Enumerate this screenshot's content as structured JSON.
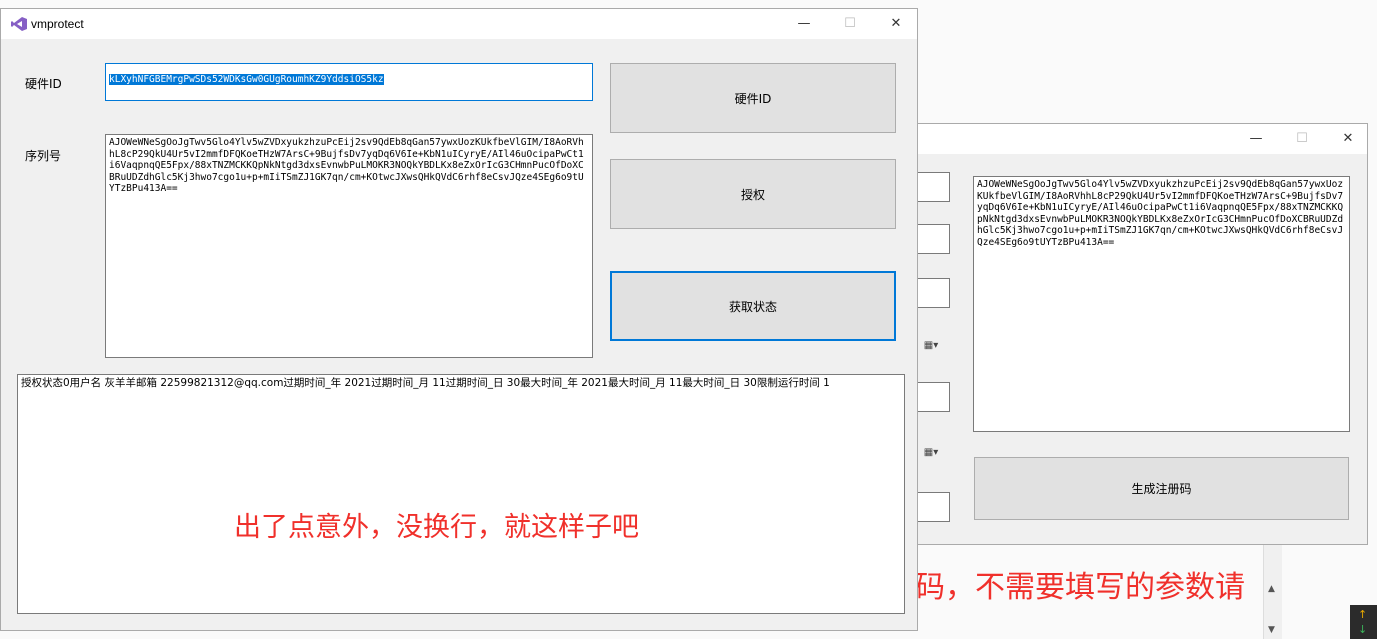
{
  "main_window": {
    "title": "vmprotect",
    "minimize": "—",
    "maximize": "☐",
    "close": "✕",
    "hardware_id_label": "硬件ID",
    "hardware_id_value": "kLXyhNFGBEMrgPwSDs52WDKsGw0GUgRoumhKZ9YddsiOS5kz",
    "serial_label": "序列号",
    "serial_value": "AJOWeWNeSgOoJgTwv5Glo4Ylv5wZVDxyukzhzuPcEij2sv9QdEb8qGan57ywxUozKUkfbeVlGIM/I8AoRVhhL8cP29QkU4Ur5vI2mmfDFQKoeTHzW7ArsC+9BujfsDv7yqDq6V6Ie+KbN1uICyryE/AIl46uOcipaPwCt1i6VaqpnqQE5Fpx/88xTNZMCKKQpNkNtgd3dxsEvnwbPuLMOKR3NOQkYBDLKx8eZxOrIcG3CHmnPucOfDoXCBRuUDZdhGlc5Kj3hwo7cgo1u+p+mIiTSmZJ1GK7qn/cm+KOtwcJXwsQHkQVdC6rhf8eCsvJQze4SEg6o9tUYTzBPu413A==",
    "btn_hardware_id": "硬件ID",
    "btn_authorize": "授权",
    "btn_get_status": "获取状态",
    "status_text": "授权状态0用户名  灰羊羊邮箱  2259982131​2@qq.com过期时间_年  2021过期时间_月  11过期时间_日  30最大时间_年 2021最大时间_月 11最大时间_日 30限制运行时间 1",
    "annotation": "出了点意外，没换行，就这样子吧"
  },
  "second_window": {
    "minimize": "—",
    "maximize": "☐",
    "close": "✕",
    "serial_value": "AJOWeWNeSgOoJgTwv5Glo4Ylv5wZVDxyukzhzuPcEij2sv9QdEb8qGan57ywxUozKUkfbeVlGIM/I8AoRVhhL8cP29QkU4Ur5vI2mmfDFQKoeTHzW7ArsC+9BujfsDv7yqDq6V6Ie+KbN1uICyryE/AIl46uOcipaPwCt1i6VaqpnqQE5Fpx/88xTNZMCKKQpNkNtgd3dxsEvnwbPuLMOKR3NOQkYBDLKx8eZxOrIcG3CHmnPucOfDoXCBRuUDZdhGlc5Kj3hwo7cgo1u+p+mIiTSmZJ1GK7qn/cm+KOtwcJXwsQHkQVdC6rhf8eCsvJQze4SEg6o9tUYTzBPu413A==",
    "btn_generate": "生成注册码"
  },
  "background_text": "码，不需要填写的参数请",
  "colors": {
    "accent": "#0078d7",
    "annotation": "#f0302b",
    "window_bg": "#f0f0f0"
  }
}
